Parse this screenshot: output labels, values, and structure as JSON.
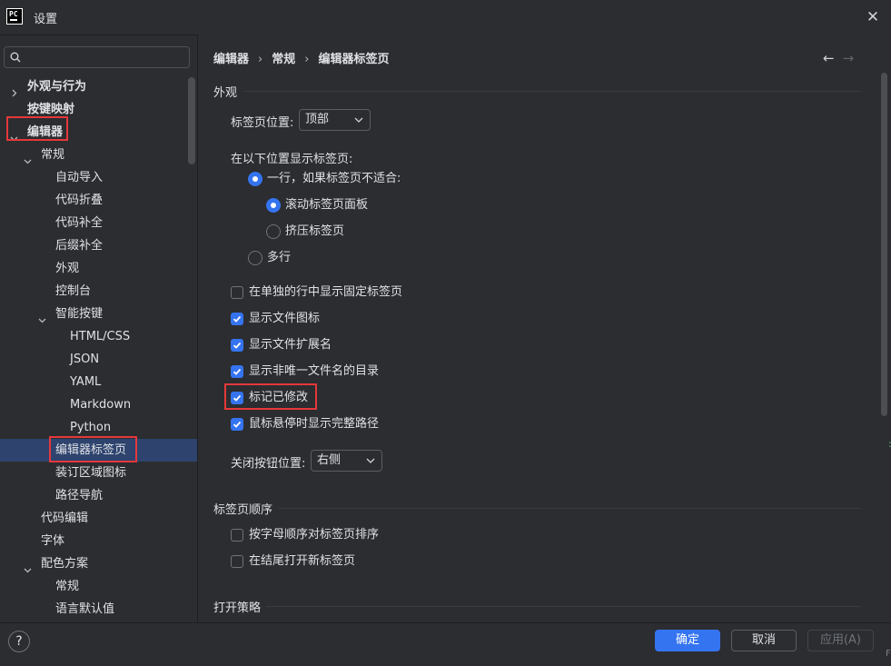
{
  "window": {
    "title": "设置",
    "logo_text": "PC"
  },
  "search": {
    "value": "",
    "placeholder": ""
  },
  "tree": [
    {
      "label": "外观与行为",
      "bold": true,
      "expanded": false,
      "has_arrow": true
    },
    {
      "label": "按键映射",
      "bold": true,
      "has_arrow": false
    },
    {
      "label": "编辑器",
      "bold": true,
      "expanded": true,
      "has_arrow": true,
      "highlighted": true
    },
    {
      "label": "常规",
      "expanded": true,
      "has_arrow": true
    },
    {
      "label": "自动导入"
    },
    {
      "label": "代码折叠"
    },
    {
      "label": "代码补全"
    },
    {
      "label": "后缀补全"
    },
    {
      "label": "外观"
    },
    {
      "label": "控制台"
    },
    {
      "label": "智能按键",
      "expanded": true,
      "has_arrow": true
    },
    {
      "label": "HTML/CSS"
    },
    {
      "label": "JSON"
    },
    {
      "label": "YAML"
    },
    {
      "label": "Markdown"
    },
    {
      "label": "Python"
    },
    {
      "label": "编辑器标签页",
      "selected": true,
      "highlighted": true
    },
    {
      "label": "装订区域图标"
    },
    {
      "label": "路径导航"
    },
    {
      "label": "代码编辑"
    },
    {
      "label": "字体"
    },
    {
      "label": "配色方案",
      "expanded": true,
      "has_arrow": true
    },
    {
      "label": "常规"
    },
    {
      "label": "语言默认值"
    }
  ],
  "breadcrumb": {
    "items": [
      "编辑器",
      "常规",
      "编辑器标签页"
    ],
    "separator": "›"
  },
  "nav": {
    "back": "←",
    "forward": "→"
  },
  "appearance": {
    "section_title": "外观",
    "tab_position_label": "标签页位置:",
    "tab_position_value": "顶部",
    "show_tabs_in_label": "在以下位置显示标签页:",
    "radio_one_row": {
      "label": "一行，如果标签页不适合:",
      "checked": true
    },
    "radio_scroll": {
      "label": "滚动标签页面板",
      "checked": true
    },
    "radio_squeeze": {
      "label": "挤压标签页",
      "checked": false
    },
    "radio_multi": {
      "label": "多行",
      "checked": false
    },
    "checkboxes": [
      {
        "label": "在单独的行中显示固定标签页",
        "checked": false
      },
      {
        "label": "显示文件图标",
        "checked": true
      },
      {
        "label": "显示文件扩展名",
        "checked": true
      },
      {
        "label": "显示非唯一文件名的目录",
        "checked": true
      },
      {
        "label": "标记已修改",
        "checked": true,
        "highlighted": true
      },
      {
        "label": "鼠标悬停时显示完整路径",
        "checked": true
      }
    ],
    "close_button_label": "关闭按钮位置:",
    "close_button_value": "右侧"
  },
  "order": {
    "section_title": "标签页顺序",
    "checkboxes": [
      {
        "label": "按字母顺序对标签页排序",
        "checked": false
      },
      {
        "label": "在结尾打开新标签页",
        "checked": false
      }
    ]
  },
  "opening": {
    "section_title": "打开策略"
  },
  "footer": {
    "help": "?",
    "ok": "确定",
    "cancel": "取消",
    "apply": "应用(A)"
  },
  "colors": {
    "accent": "#3574f0",
    "selection": "#2e436e",
    "highlight_box": "#e5383b",
    "background": "#2b2d30"
  }
}
